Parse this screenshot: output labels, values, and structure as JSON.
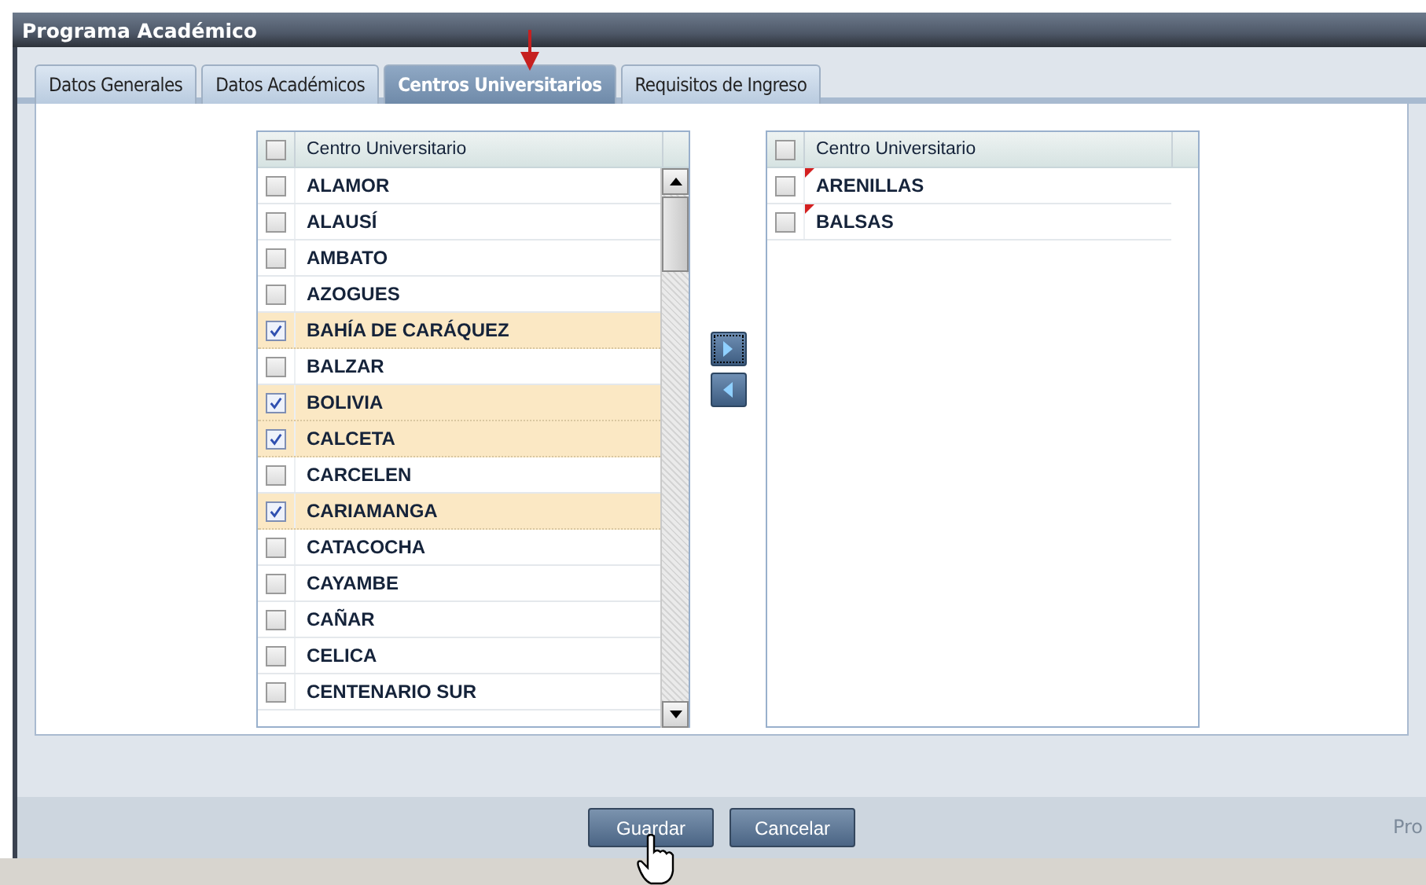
{
  "window": {
    "title": "Programa Académico"
  },
  "tabs": [
    {
      "label": "Datos Generales",
      "selected": false
    },
    {
      "label": "Datos Académicos",
      "selected": false
    },
    {
      "label": "Centros Universitarios",
      "selected": true
    },
    {
      "label": "Requisitos de Ingreso",
      "selected": false
    }
  ],
  "available": {
    "header": "Centro Universitario",
    "all_checked": false,
    "rows": [
      {
        "name": "ALAMOR",
        "checked": false
      },
      {
        "name": "ALAUSÍ",
        "checked": false
      },
      {
        "name": "AMBATO",
        "checked": false
      },
      {
        "name": "AZOGUES",
        "checked": false
      },
      {
        "name": "BAHÍA DE CARÁQUEZ",
        "checked": true
      },
      {
        "name": "BALZAR",
        "checked": false
      },
      {
        "name": "BOLIVIA",
        "checked": true
      },
      {
        "name": "CALCETA",
        "checked": true
      },
      {
        "name": "CARCELEN",
        "checked": false
      },
      {
        "name": "CARIAMANGA",
        "checked": true
      },
      {
        "name": "CATACOCHA",
        "checked": false
      },
      {
        "name": "CAYAMBE",
        "checked": false
      },
      {
        "name": "CAÑAR",
        "checked": false
      },
      {
        "name": "CELICA",
        "checked": false
      },
      {
        "name": "CENTENARIO SUR",
        "checked": false
      }
    ]
  },
  "assigned": {
    "header": "Centro Universitario",
    "all_checked": false,
    "rows": [
      {
        "name": "ARENILLAS",
        "checked": false,
        "modified": true
      },
      {
        "name": "BALSAS",
        "checked": false,
        "modified": true
      }
    ]
  },
  "footer": {
    "buttons": [
      "Guardar",
      "Cancelar"
    ],
    "right_text": "Pro"
  }
}
